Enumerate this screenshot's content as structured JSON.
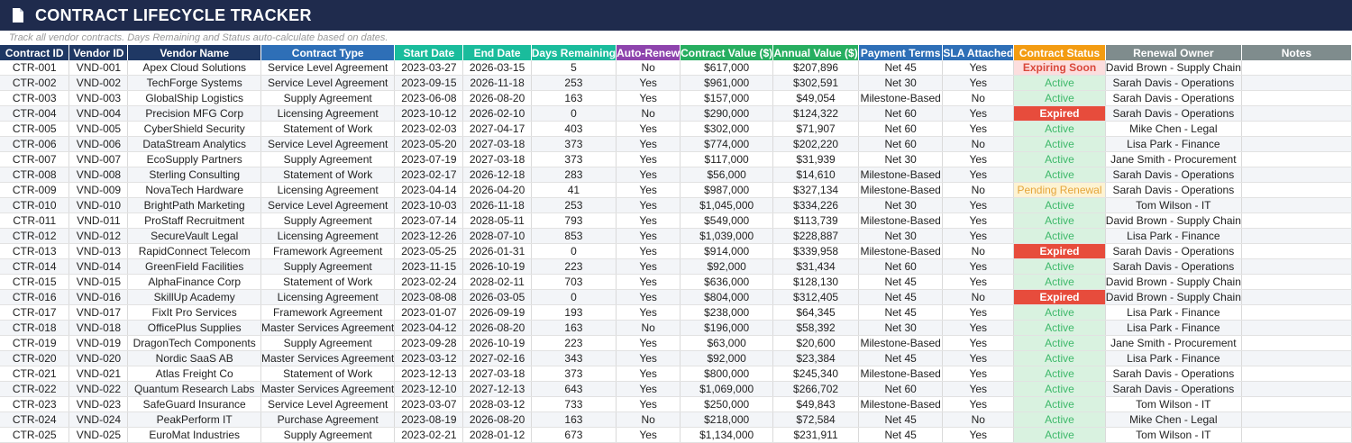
{
  "title": "CONTRACT LIFECYCLE TRACKER",
  "subtitle": "Track all vendor contracts. Days Remaining and Status auto-calculate based on dates.",
  "icons": {
    "title": "document-icon"
  },
  "colors": {
    "title_bg": "#1f2b4d",
    "header_navy": "#1f3864",
    "header_blue": "#2e6fb7",
    "header_teal": "#1abc9c",
    "header_purple": "#8e44ad",
    "header_green": "#27ae60",
    "header_orange": "#f39c12",
    "header_gray": "#7f8c8d",
    "status_active": "#3eb86a",
    "status_expired": "#e74c3c",
    "status_soon": "#d9483b",
    "status_pending": "#e5a53a"
  },
  "columns": [
    {
      "key": "id",
      "label": "Contract ID"
    },
    {
      "key": "vendor_id",
      "label": "Vendor ID"
    },
    {
      "key": "vendor",
      "label": "Vendor Name"
    },
    {
      "key": "type",
      "label": "Contract Type"
    },
    {
      "key": "start",
      "label": "Start Date"
    },
    {
      "key": "end",
      "label": "End Date"
    },
    {
      "key": "days",
      "label": "Days Remaining"
    },
    {
      "key": "auto",
      "label": "Auto-Renew"
    },
    {
      "key": "value",
      "label": "Contract Value ($)"
    },
    {
      "key": "annual",
      "label": "Annual Value ($)"
    },
    {
      "key": "terms",
      "label": "Payment Terms"
    },
    {
      "key": "sla",
      "label": "SLA Attached"
    },
    {
      "key": "status",
      "label": "Contract Status"
    },
    {
      "key": "owner",
      "label": "Renewal Owner"
    },
    {
      "key": "notes",
      "label": "Notes"
    }
  ],
  "rows": [
    {
      "id": "CTR-001",
      "vendor_id": "VND-001",
      "vendor": "Apex Cloud Solutions",
      "type": "Service Level Agreement",
      "start": "2023-03-27",
      "end": "2026-03-15",
      "days": "5",
      "auto": "No",
      "value": "$617,000",
      "annual": "$207,896",
      "terms": "Net 45",
      "sla": "Yes",
      "status": "Expiring Soon",
      "status_kind": "soon",
      "owner": "David Brown - Supply Chain",
      "notes": ""
    },
    {
      "id": "CTR-002",
      "vendor_id": "VND-002",
      "vendor": "TechForge Systems",
      "type": "Service Level Agreement",
      "start": "2023-09-15",
      "end": "2026-11-18",
      "days": "253",
      "auto": "Yes",
      "value": "$961,000",
      "annual": "$302,591",
      "terms": "Net 30",
      "sla": "Yes",
      "status": "Active",
      "status_kind": "active",
      "owner": "Sarah Davis - Operations",
      "notes": ""
    },
    {
      "id": "CTR-003",
      "vendor_id": "VND-003",
      "vendor": "GlobalShip Logistics",
      "type": "Supply Agreement",
      "start": "2023-06-08",
      "end": "2026-08-20",
      "days": "163",
      "auto": "Yes",
      "value": "$157,000",
      "annual": "$49,054",
      "terms": "Milestone-Based",
      "sla": "No",
      "status": "Active",
      "status_kind": "active",
      "owner": "Sarah Davis - Operations",
      "notes": ""
    },
    {
      "id": "CTR-004",
      "vendor_id": "VND-004",
      "vendor": "Precision MFG Corp",
      "type": "Licensing Agreement",
      "start": "2023-10-12",
      "end": "2026-02-10",
      "days": "0",
      "auto": "No",
      "value": "$290,000",
      "annual": "$124,322",
      "terms": "Net 60",
      "sla": "Yes",
      "status": "Expired",
      "status_kind": "expired",
      "owner": "Sarah Davis - Operations",
      "notes": ""
    },
    {
      "id": "CTR-005",
      "vendor_id": "VND-005",
      "vendor": "CyberShield Security",
      "type": "Statement of Work",
      "start": "2023-02-03",
      "end": "2027-04-17",
      "days": "403",
      "auto": "Yes",
      "value": "$302,000",
      "annual": "$71,907",
      "terms": "Net 60",
      "sla": "Yes",
      "status": "Active",
      "status_kind": "active",
      "owner": "Mike Chen - Legal",
      "notes": ""
    },
    {
      "id": "CTR-006",
      "vendor_id": "VND-006",
      "vendor": "DataStream Analytics",
      "type": "Service Level Agreement",
      "start": "2023-05-20",
      "end": "2027-03-18",
      "days": "373",
      "auto": "Yes",
      "value": "$774,000",
      "annual": "$202,220",
      "terms": "Net 60",
      "sla": "No",
      "status": "Active",
      "status_kind": "active",
      "owner": "Lisa Park - Finance",
      "notes": ""
    },
    {
      "id": "CTR-007",
      "vendor_id": "VND-007",
      "vendor": "EcoSupply Partners",
      "type": "Supply Agreement",
      "start": "2023-07-19",
      "end": "2027-03-18",
      "days": "373",
      "auto": "Yes",
      "value": "$117,000",
      "annual": "$31,939",
      "terms": "Net 30",
      "sla": "Yes",
      "status": "Active",
      "status_kind": "active",
      "owner": "Jane Smith - Procurement",
      "notes": ""
    },
    {
      "id": "CTR-008",
      "vendor_id": "VND-008",
      "vendor": "Sterling Consulting",
      "type": "Statement of Work",
      "start": "2023-02-17",
      "end": "2026-12-18",
      "days": "283",
      "auto": "Yes",
      "value": "$56,000",
      "annual": "$14,610",
      "terms": "Milestone-Based",
      "sla": "Yes",
      "status": "Active",
      "status_kind": "active",
      "owner": "Sarah Davis - Operations",
      "notes": ""
    },
    {
      "id": "CTR-009",
      "vendor_id": "VND-009",
      "vendor": "NovaTech Hardware",
      "type": "Licensing Agreement",
      "start": "2023-04-14",
      "end": "2026-04-20",
      "days": "41",
      "auto": "Yes",
      "value": "$987,000",
      "annual": "$327,134",
      "terms": "Milestone-Based",
      "sla": "No",
      "status": "Pending Renewal",
      "status_kind": "pending",
      "owner": "Sarah Davis - Operations",
      "notes": ""
    },
    {
      "id": "CTR-010",
      "vendor_id": "VND-010",
      "vendor": "BrightPath Marketing",
      "type": "Service Level Agreement",
      "start": "2023-10-03",
      "end": "2026-11-18",
      "days": "253",
      "auto": "Yes",
      "value": "$1,045,000",
      "annual": "$334,226",
      "terms": "Net 30",
      "sla": "Yes",
      "status": "Active",
      "status_kind": "active",
      "owner": "Tom Wilson - IT",
      "notes": ""
    },
    {
      "id": "CTR-011",
      "vendor_id": "VND-011",
      "vendor": "ProStaff Recruitment",
      "type": "Supply Agreement",
      "start": "2023-07-14",
      "end": "2028-05-11",
      "days": "793",
      "auto": "Yes",
      "value": "$549,000",
      "annual": "$113,739",
      "terms": "Milestone-Based",
      "sla": "Yes",
      "status": "Active",
      "status_kind": "active",
      "owner": "David Brown - Supply Chain",
      "notes": ""
    },
    {
      "id": "CTR-012",
      "vendor_id": "VND-012",
      "vendor": "SecureVault Legal",
      "type": "Licensing Agreement",
      "start": "2023-12-26",
      "end": "2028-07-10",
      "days": "853",
      "auto": "Yes",
      "value": "$1,039,000",
      "annual": "$228,887",
      "terms": "Net 30",
      "sla": "Yes",
      "status": "Active",
      "status_kind": "active",
      "owner": "Lisa Park - Finance",
      "notes": ""
    },
    {
      "id": "CTR-013",
      "vendor_id": "VND-013",
      "vendor": "RapidConnect Telecom",
      "type": "Framework Agreement",
      "start": "2023-05-25",
      "end": "2026-01-31",
      "days": "0",
      "auto": "Yes",
      "value": "$914,000",
      "annual": "$339,958",
      "terms": "Milestone-Based",
      "sla": "No",
      "status": "Expired",
      "status_kind": "expired",
      "owner": "Sarah Davis - Operations",
      "notes": ""
    },
    {
      "id": "CTR-014",
      "vendor_id": "VND-014",
      "vendor": "GreenField Facilities",
      "type": "Supply Agreement",
      "start": "2023-11-15",
      "end": "2026-10-19",
      "days": "223",
      "auto": "Yes",
      "value": "$92,000",
      "annual": "$31,434",
      "terms": "Net 60",
      "sla": "Yes",
      "status": "Active",
      "status_kind": "active",
      "owner": "Sarah Davis - Operations",
      "notes": ""
    },
    {
      "id": "CTR-015",
      "vendor_id": "VND-015",
      "vendor": "AlphaFinance Corp",
      "type": "Statement of Work",
      "start": "2023-02-24",
      "end": "2028-02-11",
      "days": "703",
      "auto": "Yes",
      "value": "$636,000",
      "annual": "$128,130",
      "terms": "Net 45",
      "sla": "Yes",
      "status": "Active",
      "status_kind": "active",
      "owner": "David Brown - Supply Chain",
      "notes": ""
    },
    {
      "id": "CTR-016",
      "vendor_id": "VND-016",
      "vendor": "SkillUp Academy",
      "type": "Licensing Agreement",
      "start": "2023-08-08",
      "end": "2026-03-05",
      "days": "0",
      "auto": "Yes",
      "value": "$804,000",
      "annual": "$312,405",
      "terms": "Net 45",
      "sla": "No",
      "status": "Expired",
      "status_kind": "expired",
      "owner": "David Brown - Supply Chain",
      "notes": ""
    },
    {
      "id": "CTR-017",
      "vendor_id": "VND-017",
      "vendor": "FixIt Pro Services",
      "type": "Framework Agreement",
      "start": "2023-01-07",
      "end": "2026-09-19",
      "days": "193",
      "auto": "Yes",
      "value": "$238,000",
      "annual": "$64,345",
      "terms": "Net 45",
      "sla": "Yes",
      "status": "Active",
      "status_kind": "active",
      "owner": "Lisa Park - Finance",
      "notes": ""
    },
    {
      "id": "CTR-018",
      "vendor_id": "VND-018",
      "vendor": "OfficePlus Supplies",
      "type": "Master Services Agreement",
      "start": "2023-04-12",
      "end": "2026-08-20",
      "days": "163",
      "auto": "No",
      "value": "$196,000",
      "annual": "$58,392",
      "terms": "Net 30",
      "sla": "Yes",
      "status": "Active",
      "status_kind": "active",
      "owner": "Lisa Park - Finance",
      "notes": ""
    },
    {
      "id": "CTR-019",
      "vendor_id": "VND-019",
      "vendor": "DragonTech Components",
      "type": "Supply Agreement",
      "start": "2023-09-28",
      "end": "2026-10-19",
      "days": "223",
      "auto": "Yes",
      "value": "$63,000",
      "annual": "$20,600",
      "terms": "Milestone-Based",
      "sla": "Yes",
      "status": "Active",
      "status_kind": "active",
      "owner": "Jane Smith - Procurement",
      "notes": ""
    },
    {
      "id": "CTR-020",
      "vendor_id": "VND-020",
      "vendor": "Nordic SaaS AB",
      "type": "Master Services Agreement",
      "start": "2023-03-12",
      "end": "2027-02-16",
      "days": "343",
      "auto": "Yes",
      "value": "$92,000",
      "annual": "$23,384",
      "terms": "Net 45",
      "sla": "Yes",
      "status": "Active",
      "status_kind": "active",
      "owner": "Lisa Park - Finance",
      "notes": ""
    },
    {
      "id": "CTR-021",
      "vendor_id": "VND-021",
      "vendor": "Atlas Freight Co",
      "type": "Statement of Work",
      "start": "2023-12-13",
      "end": "2027-03-18",
      "days": "373",
      "auto": "Yes",
      "value": "$800,000",
      "annual": "$245,340",
      "terms": "Milestone-Based",
      "sla": "Yes",
      "status": "Active",
      "status_kind": "active",
      "owner": "Sarah Davis - Operations",
      "notes": ""
    },
    {
      "id": "CTR-022",
      "vendor_id": "VND-022",
      "vendor": "Quantum Research Labs",
      "type": "Master Services Agreement",
      "start": "2023-12-10",
      "end": "2027-12-13",
      "days": "643",
      "auto": "Yes",
      "value": "$1,069,000",
      "annual": "$266,702",
      "terms": "Net 60",
      "sla": "Yes",
      "status": "Active",
      "status_kind": "active",
      "owner": "Sarah Davis - Operations",
      "notes": ""
    },
    {
      "id": "CTR-023",
      "vendor_id": "VND-023",
      "vendor": "SafeGuard Insurance",
      "type": "Service Level Agreement",
      "start": "2023-03-07",
      "end": "2028-03-12",
      "days": "733",
      "auto": "Yes",
      "value": "$250,000",
      "annual": "$49,843",
      "terms": "Milestone-Based",
      "sla": "Yes",
      "status": "Active",
      "status_kind": "active",
      "owner": "Tom Wilson - IT",
      "notes": ""
    },
    {
      "id": "CTR-024",
      "vendor_id": "VND-024",
      "vendor": "PeakPerform IT",
      "type": "Purchase Agreement",
      "start": "2023-08-19",
      "end": "2026-08-20",
      "days": "163",
      "auto": "No",
      "value": "$218,000",
      "annual": "$72,584",
      "terms": "Net 45",
      "sla": "No",
      "status": "Active",
      "status_kind": "active",
      "owner": "Mike Chen - Legal",
      "notes": ""
    },
    {
      "id": "CTR-025",
      "vendor_id": "VND-025",
      "vendor": "EuroMat Industries",
      "type": "Supply Agreement",
      "start": "2023-02-21",
      "end": "2028-01-12",
      "days": "673",
      "auto": "Yes",
      "value": "$1,134,000",
      "annual": "$231,911",
      "terms": "Net 45",
      "sla": "Yes",
      "status": "Active",
      "status_kind": "active",
      "owner": "Tom Wilson - IT",
      "notes": ""
    }
  ]
}
